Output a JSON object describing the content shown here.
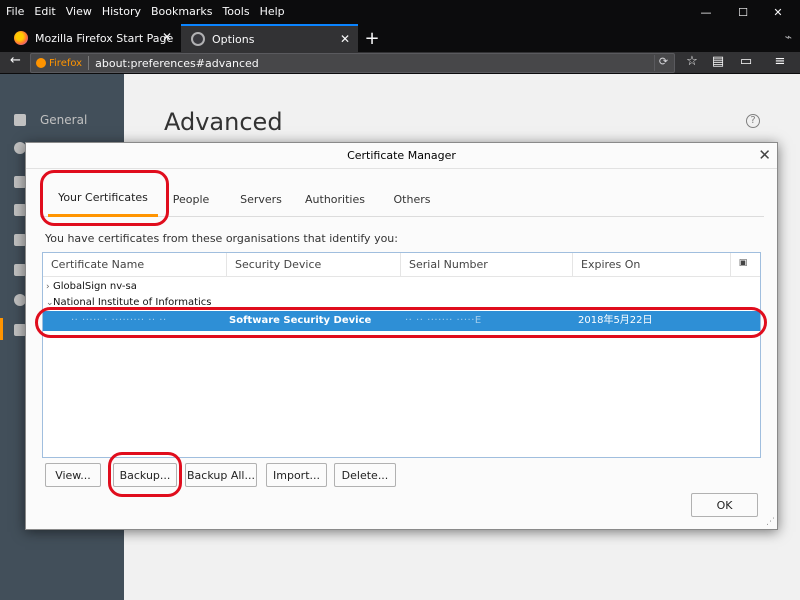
{
  "menubar": {
    "items": [
      "File",
      "Edit",
      "View",
      "History",
      "Bookmarks",
      "Tools",
      "Help"
    ],
    "minimize": "—",
    "maximize": "☐",
    "close": "✕"
  },
  "tabs": [
    {
      "title": "Mozilla Firefox Start Page",
      "close": "✕"
    },
    {
      "title": "Options",
      "close": "✕"
    }
  ],
  "new_tab": "+",
  "navbar": {
    "back": "←",
    "identity_label": "Firefox",
    "url": "about:preferences#advanced",
    "reload": "⟳",
    "icons": [
      "star-icon",
      "reading-list-icon",
      "sidebar-icon",
      "hamburger-menu-icon"
    ]
  },
  "prefs": {
    "sidebar_items": [
      {
        "label": "General",
        "icon": "general-icon"
      },
      {
        "label": "",
        "icon": "search-icon"
      },
      {
        "label": "",
        "icon": "content-icon"
      },
      {
        "label": "",
        "icon": "applications-icon"
      },
      {
        "label": "",
        "icon": "privacy-icon"
      },
      {
        "label": "",
        "icon": "security-icon"
      },
      {
        "label": "",
        "icon": "sync-icon"
      },
      {
        "label": "",
        "icon": "advanced-icon"
      }
    ],
    "title": "Advanced",
    "help": "?"
  },
  "dialog": {
    "title": "Certificate Manager",
    "close": "✕",
    "tabs": [
      "Your Certificates",
      "People",
      "Servers",
      "Authorities",
      "Others"
    ],
    "selected_tab": "Your Certificates",
    "description": "You have certificates from these organisations that identify you:",
    "columns": [
      "Certificate Name",
      "Security Device",
      "Serial Number",
      "Expires On"
    ],
    "rows": [
      {
        "twisty": "›",
        "name": "GlobalSign nv-sa"
      },
      {
        "twisty": "⌄",
        "name": "National Institute of Informatics"
      }
    ],
    "selected_row": {
      "name": "·· ·····  ·  ·········  ·· ··",
      "device": "Software Security Device",
      "serial": "·· ·· ······· ·····E",
      "expires": "2018年5月22日"
    },
    "buttons": [
      "View...",
      "Backup...",
      "Backup All...",
      "Import...",
      "Delete..."
    ],
    "ok": "OK"
  },
  "colors": {
    "annotation": "#e00d1d",
    "selection": "#2e8fd6",
    "tab_accent": "#ff9400"
  }
}
